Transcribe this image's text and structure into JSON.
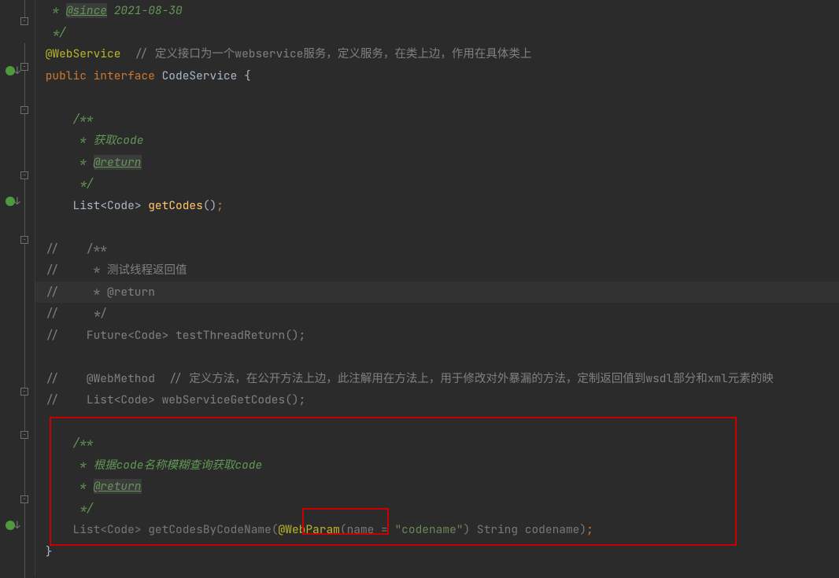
{
  "lines": {
    "l0_indent": "  ",
    "l0_star": "* ",
    "l0_tag": "@since",
    "l0_date": " 2021-08-30",
    "l1_indent": "  ",
    "l1_end": "*/",
    "l2_anno": " @WebService",
    "l2_comment": "  // 定义接口为一个webservice服务，定义服务，在类上边，作用在具体类上",
    "l3_public": " public ",
    "l3_interface": "interface ",
    "l3_name": "CodeService ",
    "l3_brace": "{",
    "l5_indent": "     ",
    "l5_start": "/**",
    "l6_indent": "      ",
    "l6_text": "* 获取code",
    "l7_indent": "      ",
    "l7_star": "* ",
    "l7_tag": "@return",
    "l8_indent": "      ",
    "l8_end": "*/",
    "l9_indent": "     ",
    "l9_list": "List",
    "l9_lt": "<",
    "l9_code": "Code",
    "l9_gt": "> ",
    "l9_method": "getCodes",
    "l9_parens": "()",
    "l9_semi": ";",
    "l11_cmt": " //    /**",
    "l12_cmt": " //     * 测试线程返回值",
    "l13_cmt": " //     * @return",
    "l14_cmt": " //     */",
    "l15_cmt": " //    Future<Code> testThreadReturn();",
    "l17_slash": " //    ",
    "l17_anno": "@WebMethod ",
    "l17_rest": " // 定义方法，在公开方法上边，此注解用在方法上，用于修改对外暴漏的方法，定制返回值到wsdl部分和xml元素的映",
    "l18_cmt": " //    List<Code> webServiceGetCodes();",
    "l20_indent": "     ",
    "l20_start": "/**",
    "l21_indent": "      ",
    "l21_text": "* 根据code名称模糊查询获取code",
    "l22_indent": "      ",
    "l22_star": "* ",
    "l22_tag": "@return",
    "l23_indent": "      ",
    "l23_end": "*/",
    "l24_indent": "     ",
    "l24_list": "List",
    "l24_lt": "<",
    "l24_code": "Code",
    "l24_gt": "> ",
    "l24_method": "getCodesByCodeName",
    "l24_open": "(",
    "l24_anno": "@WebParam",
    "l24_nameopen": "(",
    "l24_namekey": "name = ",
    "l24_str": "\"codename\"",
    "l24_nameclose": ") ",
    "l24_string": "String ",
    "l24_param": "codename",
    "l24_close": ")",
    "l24_semi": ";",
    "l25_brace": " }"
  }
}
